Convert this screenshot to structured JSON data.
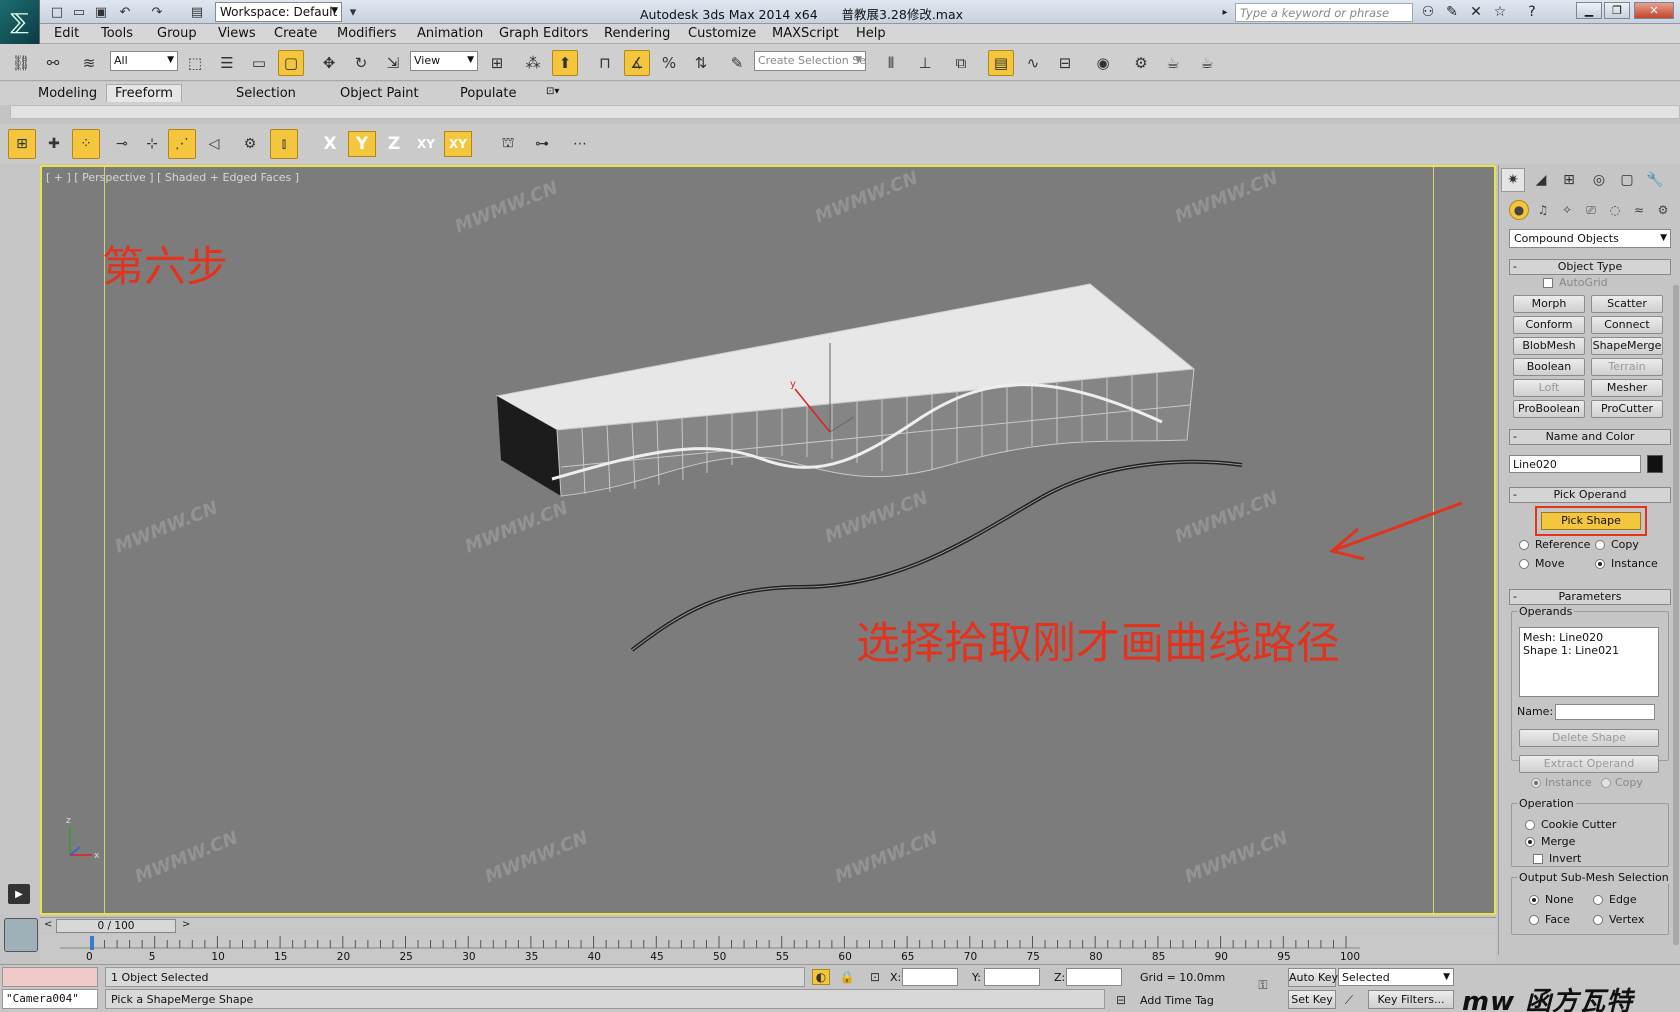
{
  "titlebar": {
    "workspace": "Workspace: Default",
    "app_name": "Autodesk 3ds Max  2014 x64",
    "file_name": "普教展3.28修改.max",
    "search_placeholder": "Type a keyword or phrase"
  },
  "menu": [
    "Edit",
    "Tools",
    "Group",
    "Views",
    "Create",
    "Modifiers",
    "Animation",
    "Graph Editors",
    "Rendering",
    "Customize",
    "MAXScript",
    "Help"
  ],
  "toolbar": {
    "selection_filter": "All",
    "reference_coord": "View",
    "named_selection_placeholder": "Create Selection Se"
  },
  "ribbon_tabs": [
    "Modeling",
    "Freeform",
    "Selection",
    "Object Paint",
    "Populate"
  ],
  "ribbon_active_tab": "Freeform",
  "axis_buttons": [
    "X",
    "Y",
    "Z",
    "XY",
    "XY"
  ],
  "axis_active": "Y",
  "viewport": {
    "label": "[ + ] [ Perspective ] [ Shaded + Edged Faces ]",
    "step_text": "第六步",
    "instruction_text": "选择拾取刚才画曲线路径",
    "watermark": "MWMW.CN",
    "gizmo_y": "y",
    "gizmo_z": "z",
    "axis_z": "z",
    "axis_x": "x"
  },
  "command_panel": {
    "category": "Compound Objects",
    "object_type_title": "Object Type",
    "autogrid_label": "AutoGrid",
    "buttons": [
      {
        "label": "Morph",
        "enabled": true
      },
      {
        "label": "Scatter",
        "enabled": true
      },
      {
        "label": "Conform",
        "enabled": true
      },
      {
        "label": "Connect",
        "enabled": true
      },
      {
        "label": "BlobMesh",
        "enabled": true
      },
      {
        "label": "ShapeMerge",
        "enabled": true
      },
      {
        "label": "Boolean",
        "enabled": true
      },
      {
        "label": "Terrain",
        "enabled": false
      },
      {
        "label": "Loft",
        "enabled": false
      },
      {
        "label": "Mesher",
        "enabled": true
      },
      {
        "label": "ProBoolean",
        "enabled": true
      },
      {
        "label": "ProCutter",
        "enabled": true
      }
    ],
    "name_color_title": "Name and Color",
    "object_name": "Line020",
    "object_color": "#111111",
    "pick_operand_title": "Pick Operand",
    "pick_shape_label": "Pick Shape",
    "pick_options": {
      "reference": "Reference",
      "copy": "Copy",
      "move": "Move",
      "instance": "Instance",
      "selected": "Instance"
    },
    "parameters_title": "Parameters",
    "operands_label": "Operands",
    "operands": [
      "Mesh: Line020",
      "Shape 1: Line021"
    ],
    "name_label": "Name:",
    "delete_shape_label": "Delete Shape",
    "extract_operand_label": "Extract Operand",
    "extract_instance": "Instance",
    "extract_copy": "Copy",
    "operation_label": "Operation",
    "cookie_cutter": "Cookie Cutter",
    "merge": "Merge",
    "invert": "Invert",
    "operation_selected": "Merge",
    "output_label": "Output Sub-Mesh Selection",
    "output_none": "None",
    "output_edge": "Edge",
    "output_face": "Face",
    "output_vertex": "Vertex",
    "output_selected": "None"
  },
  "time_slider": {
    "frame_text": "0 / 100",
    "ticks": [
      0,
      5,
      10,
      15,
      20,
      25,
      30,
      35,
      40,
      45,
      50,
      55,
      60,
      65,
      70,
      75,
      80,
      85,
      90,
      95,
      100
    ]
  },
  "status": {
    "camera": "\"Camera004\"",
    "line1": "1 Object Selected",
    "line2": "Pick a ShapeMerge Shape",
    "x_label": "X:",
    "y_label": "Y:",
    "z_label": "Z:",
    "grid": "Grid = 10.0mm",
    "add_time_tag": "Add Time Tag",
    "auto_key": "Auto Key",
    "set_key": "Set Key",
    "selected_dd": "Selected",
    "key_filters": "Key Filters..."
  },
  "brand": "mw 函方瓦特",
  "colors": {
    "accent_active": "#f3c63e",
    "annotation_red": "#e2331f",
    "viewport_bg": "#7c7c7c",
    "viewport_border": "#e9e34a"
  }
}
